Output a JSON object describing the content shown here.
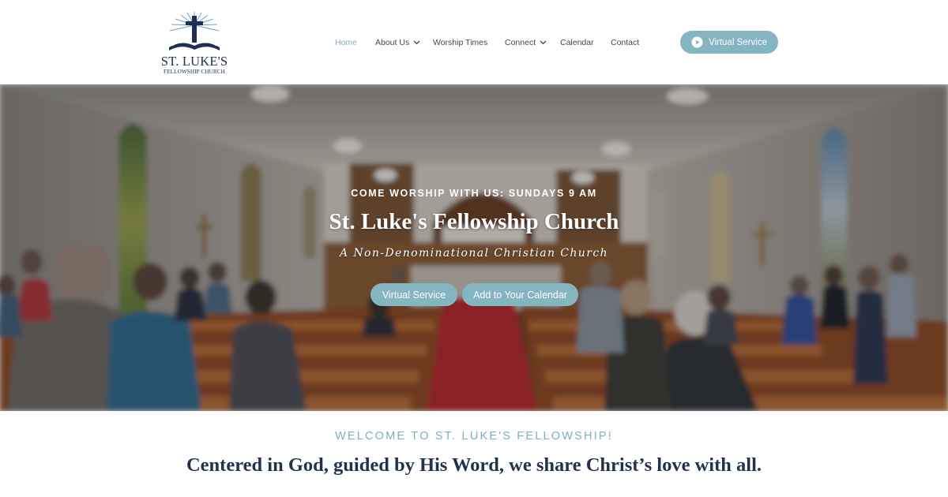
{
  "brand": {
    "name": "ST. LUKE'S",
    "subtitle": "FELLOWSHIP CHURCH"
  },
  "nav": {
    "items": [
      {
        "label": "Home",
        "active": true,
        "dropdown": false
      },
      {
        "label": "About Us",
        "active": false,
        "dropdown": true
      },
      {
        "label": "Worship Times",
        "active": false,
        "dropdown": false
      },
      {
        "label": "Connect",
        "active": false,
        "dropdown": true
      },
      {
        "label": "Calendar",
        "active": false,
        "dropdown": false
      },
      {
        "label": "Contact",
        "active": false,
        "dropdown": false
      }
    ],
    "cta": {
      "label": "Virtual Service",
      "icon": "play-circle-icon"
    }
  },
  "hero": {
    "kicker": "COME WORSHIP WITH US: SUNDAYS 9 AM",
    "title": "St. Luke's Fellowship Church",
    "tagline": "A Non-Denominational Christian Church",
    "buttons": [
      {
        "label": "Virtual Service"
      },
      {
        "label": "Add to Your Calendar"
      }
    ]
  },
  "welcome": {
    "kicker": "WELCOME TO ST. LUKE'S FELLOWSHIP!",
    "text": "Centered in God, guided by His Word, we share Christ’s love with all."
  },
  "colors": {
    "accent": "#85b5c1",
    "active_nav": "#7fb0c0",
    "nav_text": "#3b4a55",
    "brand_navy": "#1d2d54",
    "heading_navy": "#22324f"
  }
}
